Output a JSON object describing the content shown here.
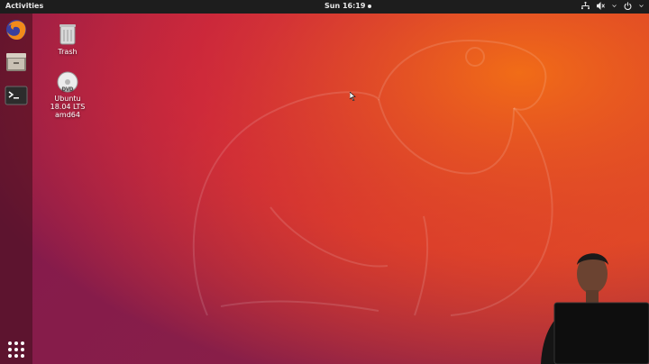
{
  "topbar": {
    "activities_label": "Activities",
    "clock_label": "Sun 16:19"
  },
  "dock": {
    "items": [
      {
        "icon": "firefox-icon"
      },
      {
        "icon": "files-icon"
      },
      {
        "icon": "terminal-icon"
      },
      {
        "icon": "app-grid-icon"
      }
    ]
  },
  "desktop": {
    "icons": [
      {
        "label": "Trash",
        "icon": "trash-icon"
      },
      {
        "label_line1": "Ubuntu",
        "label_line2": "18.04 LTS",
        "label_line3": "amd64",
        "icon": "dvd-icon"
      }
    ]
  },
  "colors": {
    "topbar": "#1d1d1d",
    "wallpaper_left": "#b1163f",
    "wallpaper_right": "#f06a0f"
  }
}
